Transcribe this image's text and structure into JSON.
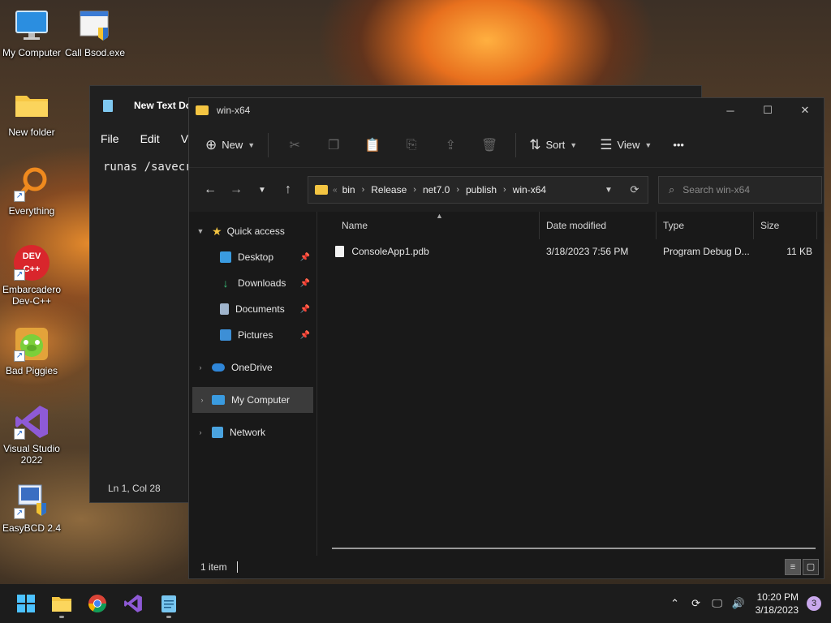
{
  "desktop": {
    "icons": [
      {
        "label": "My Computer",
        "icon": "monitor-icon"
      },
      {
        "label": "Call Bsod.exe",
        "icon": "exe-icon"
      },
      {
        "label": "New folder",
        "icon": "folder-icon"
      },
      {
        "label": "Everything",
        "icon": "magnifier-icon"
      },
      {
        "label": "Embarcadero Dev-C++",
        "icon": "devcpp-icon"
      },
      {
        "label": "Bad Piggies",
        "icon": "pig-icon"
      },
      {
        "label": "Visual Studio 2022",
        "icon": "visual-studio-icon"
      },
      {
        "label": "EasyBCD 2.4",
        "icon": "easybcd-icon"
      }
    ],
    "devcpp_logo": "DEV C++"
  },
  "notepad": {
    "title": "New Text Do",
    "menu": [
      "File",
      "Edit",
      "V"
    ],
    "text": "runas /savecr",
    "status": "Ln 1, Col 28"
  },
  "explorer": {
    "title": "win-x64",
    "toolbar": {
      "new_label": "New",
      "sort_label": "Sort",
      "view_label": "View",
      "more": "•••"
    },
    "breadcrumb": [
      "bin",
      "Release",
      "net7.0",
      "publish",
      "win-x64"
    ],
    "search_placeholder": "Search win-x64",
    "nav": {
      "quick_access": "Quick access",
      "desktop": "Desktop",
      "downloads": "Downloads",
      "documents": "Documents",
      "pictures": "Pictures",
      "onedrive": "OneDrive",
      "my_computer": "My Computer",
      "network": "Network"
    },
    "columns": {
      "name": "Name",
      "date": "Date modified",
      "type": "Type",
      "size": "Size"
    },
    "files": [
      {
        "name": "ConsoleApp1.pdb",
        "date": "3/18/2023 7:56 PM",
        "type": "Program Debug D...",
        "size": "11 KB"
      }
    ],
    "status": "1 item"
  },
  "taskbar": {
    "time": "10:20 PM",
    "date": "3/18/2023",
    "notifications": "3",
    "accent": "#0078d4"
  }
}
